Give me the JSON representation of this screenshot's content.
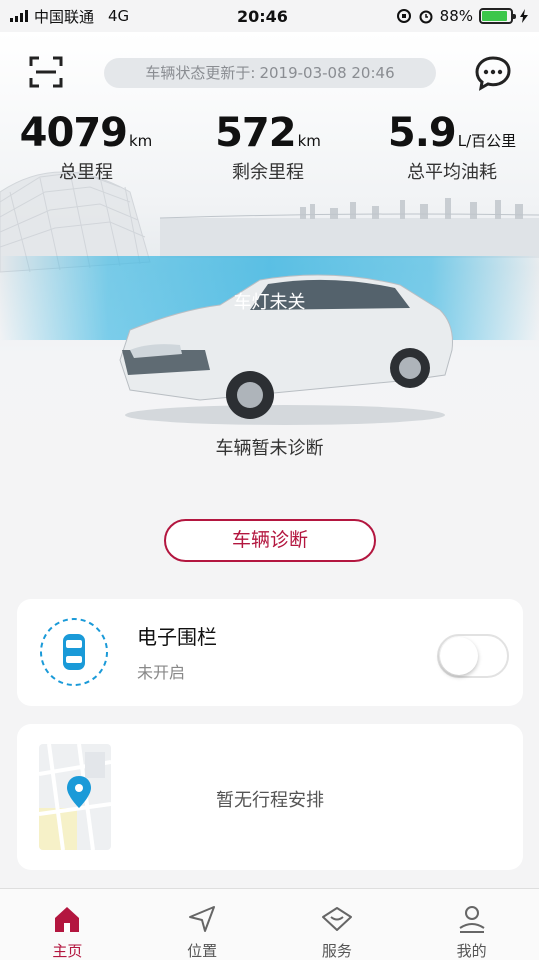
{
  "status_bar": {
    "carrier": "中国联通",
    "network": "4G",
    "time": "20:46",
    "battery_percent": "88%",
    "battery_level": 0.88
  },
  "header": {
    "update_label": "车辆状态更新于:",
    "update_time": "2019-03-08 20:46"
  },
  "stats": [
    {
      "value": "4079",
      "unit": "km",
      "label": "总里程"
    },
    {
      "value": "572",
      "unit": "km",
      "label": "剩余里程"
    },
    {
      "value": "5.9",
      "unit": "L/百公里",
      "label": "总平均油耗"
    }
  ],
  "alert": {
    "text": "车灯未关"
  },
  "diagnosis": {
    "status_text": "车辆暂未诊断",
    "button_label": "车辆诊断"
  },
  "fence": {
    "title": "电子围栏",
    "status": "未开启",
    "enabled": false
  },
  "trip": {
    "empty_text": "暂无行程安排"
  },
  "nav": [
    {
      "label": "主页",
      "icon": "home-icon",
      "active": true
    },
    {
      "label": "位置",
      "icon": "location-arrow-icon",
      "active": false
    },
    {
      "label": "服务",
      "icon": "service-icon",
      "active": false
    },
    {
      "label": "我的",
      "icon": "profile-icon",
      "active": false
    }
  ],
  "colors": {
    "accent": "#b3163f",
    "alert_blue": "#3cb9e4",
    "fence_blue": "#1a9ad8"
  }
}
